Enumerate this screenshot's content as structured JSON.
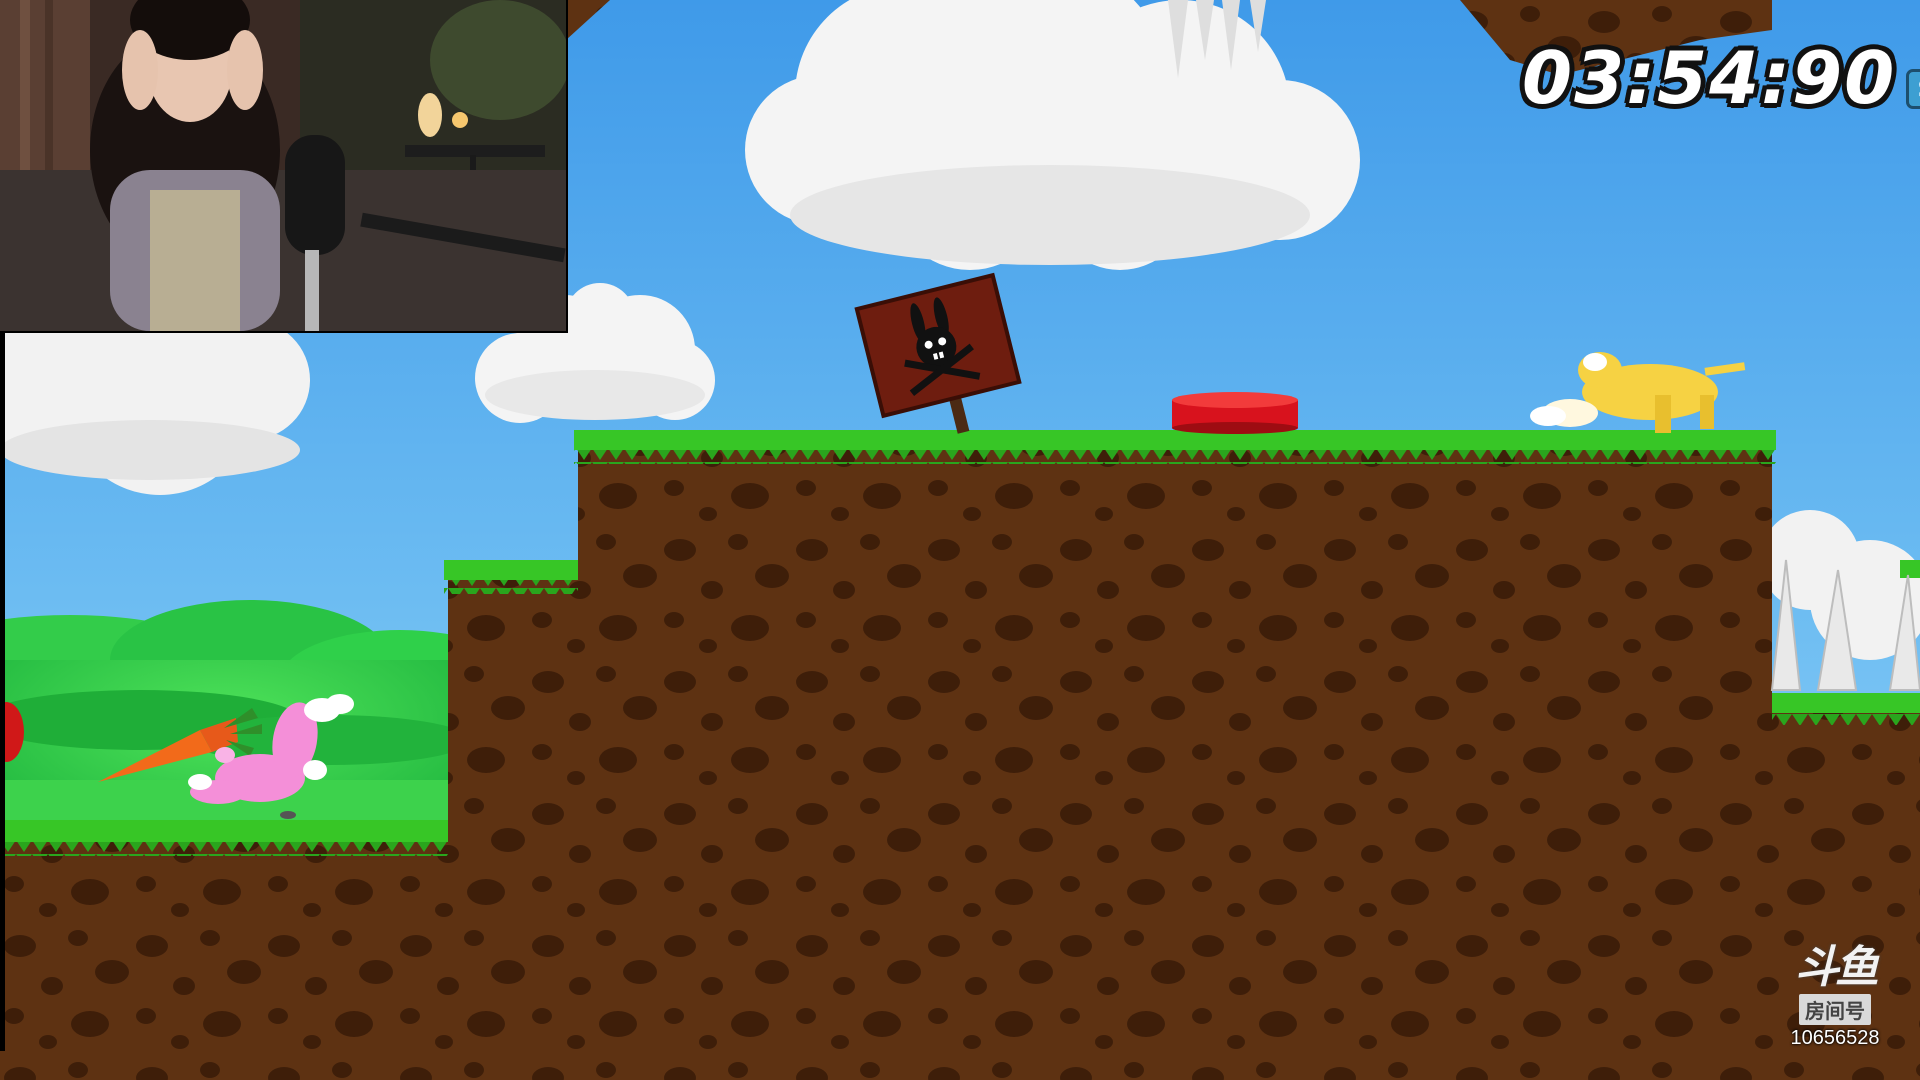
{
  "hud": {
    "timer": "03:54:90",
    "timer_badge": "S"
  },
  "watermark": {
    "brand": "斗鱼",
    "room_label": "房间号",
    "room_number": "10656528"
  },
  "webcam": {
    "icon": "streamer-webcam-feed"
  },
  "scene_objects": {
    "warning_sign_icon": "bunny-skull-crossbones",
    "button_color": "#d8121d",
    "player_pink_color": "#f48fd8",
    "player_yellow_color": "#f6d243",
    "sky_color": "#55aef0",
    "grass_color": "#37c626",
    "dirt_color": "#5e3212"
  }
}
